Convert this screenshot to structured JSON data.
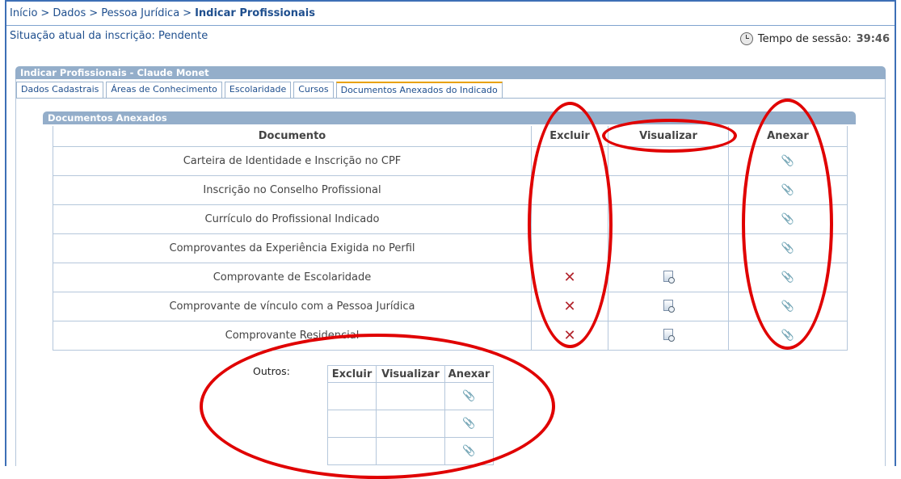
{
  "breadcrumb": {
    "items": [
      "Início",
      "Dados",
      "Pessoa Jurídica"
    ],
    "separator": ">",
    "current": "Indicar Profissionais"
  },
  "status": {
    "text": "Situação atual da inscrição: Pendente"
  },
  "session": {
    "label": "Tempo de sessão:",
    "value": "39:46",
    "icon": "clock-icon"
  },
  "panel": {
    "title": "Indicar Profissionais - Claude Monet"
  },
  "tabs": [
    {
      "label": "Dados Cadastrais"
    },
    {
      "label": "Áreas de Conhecimento"
    },
    {
      "label": "Escolaridade"
    },
    {
      "label": "Cursos"
    },
    {
      "label": "Documentos Anexados do Indicado",
      "active": true
    }
  ],
  "docs": {
    "title": "Documentos Anexados",
    "columns": {
      "documento": "Documento",
      "excluir": "Excluir",
      "visualizar": "Visualizar",
      "anexar": "Anexar"
    },
    "rows": [
      {
        "name": "Carteira de Identidade e Inscrição no CPF",
        "excluir": false,
        "visualizar": false,
        "anexar": true
      },
      {
        "name": "Inscrição no Conselho Profissional",
        "excluir": false,
        "visualizar": false,
        "anexar": true
      },
      {
        "name": "Currículo do Profissional Indicado",
        "excluir": false,
        "visualizar": false,
        "anexar": true
      },
      {
        "name": "Comprovantes da Experiência Exigida no Perfil",
        "excluir": false,
        "visualizar": false,
        "anexar": true
      },
      {
        "name": "Comprovante de Escolaridade",
        "excluir": true,
        "visualizar": true,
        "anexar": true
      },
      {
        "name": "Comprovante de vínculo com a Pessoa Jurídica",
        "excluir": true,
        "visualizar": true,
        "anexar": true
      },
      {
        "name": "Comprovante Residencial",
        "excluir": true,
        "visualizar": true,
        "anexar": true
      }
    ]
  },
  "outros": {
    "label": "Outros:",
    "columns": {
      "excluir": "Excluir",
      "visualizar": "Visualizar",
      "anexar": "Anexar"
    },
    "row_count": 3
  },
  "icons": {
    "delete": "✕",
    "attach": "📎"
  },
  "colors": {
    "annotation": "#e00000",
    "link": "#1f4f8e",
    "header_bar": "#94aeca"
  }
}
